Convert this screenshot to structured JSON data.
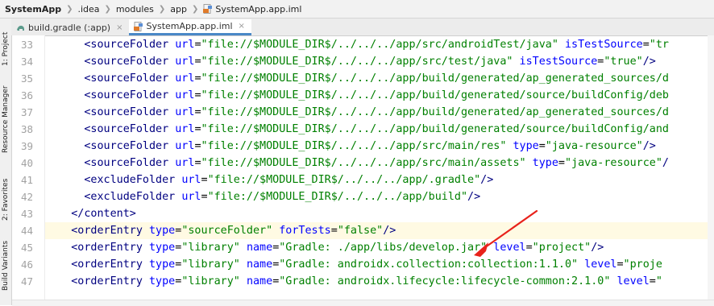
{
  "breadcrumb": [
    {
      "label": "SystemApp",
      "bold": true
    },
    {
      "label": ".idea"
    },
    {
      "label": "modules"
    },
    {
      "label": "app"
    },
    {
      "label": "SystemApp.app.iml",
      "icon": "xml-file-icon"
    }
  ],
  "tabs": [
    {
      "label": "build.gradle (:app)",
      "icon": "gradle-file-icon",
      "active": false
    },
    {
      "label": "SystemApp.app.iml",
      "icon": "xml-file-icon",
      "active": true
    }
  ],
  "side_panels": [
    "1: Project",
    "Resource Manager",
    "2: Favorites",
    "Build Variants"
  ],
  "lines": [
    {
      "n": "33",
      "indent": "      ",
      "tokens": [
        [
          "tag",
          "<sourceFolder "
        ],
        [
          "attr",
          "url"
        ],
        [
          "punct",
          "="
        ],
        [
          "val",
          "\"file://$MODULE_DIR$/../../../app/src/androidTest/java\""
        ],
        [
          "punct",
          " "
        ],
        [
          "attr",
          "isTestSource"
        ],
        [
          "punct",
          "="
        ],
        [
          "val",
          "\"tr"
        ]
      ]
    },
    {
      "n": "34",
      "indent": "      ",
      "tokens": [
        [
          "tag",
          "<sourceFolder "
        ],
        [
          "attr",
          "url"
        ],
        [
          "punct",
          "="
        ],
        [
          "val",
          "\"file://$MODULE_DIR$/../../../app/src/test/java\""
        ],
        [
          "punct",
          " "
        ],
        [
          "attr",
          "isTestSource"
        ],
        [
          "punct",
          "="
        ],
        [
          "val",
          "\"true\""
        ],
        [
          "tag",
          "/>"
        ]
      ]
    },
    {
      "n": "35",
      "indent": "      ",
      "tokens": [
        [
          "tag",
          "<sourceFolder "
        ],
        [
          "attr",
          "url"
        ],
        [
          "punct",
          "="
        ],
        [
          "val",
          "\"file://$MODULE_DIR$/../../../app/build/generated/ap_generated_sources/d"
        ]
      ]
    },
    {
      "n": "36",
      "indent": "      ",
      "tokens": [
        [
          "tag",
          "<sourceFolder "
        ],
        [
          "attr",
          "url"
        ],
        [
          "punct",
          "="
        ],
        [
          "val",
          "\"file://$MODULE_DIR$/../../../app/build/generated/source/buildConfig/deb"
        ]
      ]
    },
    {
      "n": "37",
      "indent": "      ",
      "tokens": [
        [
          "tag",
          "<sourceFolder "
        ],
        [
          "attr",
          "url"
        ],
        [
          "punct",
          "="
        ],
        [
          "val",
          "\"file://$MODULE_DIR$/../../../app/build/generated/ap_generated_sources/d"
        ]
      ]
    },
    {
      "n": "38",
      "indent": "      ",
      "tokens": [
        [
          "tag",
          "<sourceFolder "
        ],
        [
          "attr",
          "url"
        ],
        [
          "punct",
          "="
        ],
        [
          "val",
          "\"file://$MODULE_DIR$/../../../app/build/generated/source/buildConfig/and"
        ]
      ]
    },
    {
      "n": "39",
      "indent": "      ",
      "tokens": [
        [
          "tag",
          "<sourceFolder "
        ],
        [
          "attr",
          "url"
        ],
        [
          "punct",
          "="
        ],
        [
          "val",
          "\"file://$MODULE_DIR$/../../../app/src/main/res\""
        ],
        [
          "punct",
          " "
        ],
        [
          "attr",
          "type"
        ],
        [
          "punct",
          "="
        ],
        [
          "val",
          "\"java-resource\""
        ],
        [
          "tag",
          "/>"
        ]
      ]
    },
    {
      "n": "40",
      "indent": "      ",
      "tokens": [
        [
          "tag",
          "<sourceFolder "
        ],
        [
          "attr",
          "url"
        ],
        [
          "punct",
          "="
        ],
        [
          "val",
          "\"file://$MODULE_DIR$/../../../app/src/main/assets\""
        ],
        [
          "punct",
          " "
        ],
        [
          "attr",
          "type"
        ],
        [
          "punct",
          "="
        ],
        [
          "val",
          "\"java-resource\""
        ],
        [
          "tag",
          "/"
        ]
      ]
    },
    {
      "n": "41",
      "indent": "      ",
      "tokens": [
        [
          "tag",
          "<excludeFolder "
        ],
        [
          "attr",
          "url"
        ],
        [
          "punct",
          "="
        ],
        [
          "val",
          "\"file://$MODULE_DIR$/../../../app/.gradle\""
        ],
        [
          "tag",
          "/>"
        ]
      ]
    },
    {
      "n": "42",
      "indent": "      ",
      "tokens": [
        [
          "tag",
          "<excludeFolder "
        ],
        [
          "attr",
          "url"
        ],
        [
          "punct",
          "="
        ],
        [
          "val",
          "\"file://$MODULE_DIR$/../../../app/build\""
        ],
        [
          "tag",
          "/>"
        ]
      ]
    },
    {
      "n": "43",
      "indent": "    ",
      "tokens": [
        [
          "tag",
          "</content>"
        ]
      ]
    },
    {
      "n": "44",
      "indent": "    ",
      "current": true,
      "tokens": [
        [
          "tag",
          "<orderEntry "
        ],
        [
          "attr",
          "type"
        ],
        [
          "punct",
          "="
        ],
        [
          "val",
          "\"sourceFolder\""
        ],
        [
          "punct",
          " "
        ],
        [
          "attr",
          "forTests"
        ],
        [
          "punct",
          "="
        ],
        [
          "val",
          "\"false\""
        ],
        [
          "tag",
          "/>"
        ]
      ]
    },
    {
      "n": "45",
      "indent": "    ",
      "tokens": [
        [
          "tag",
          "<orderEntry "
        ],
        [
          "attr",
          "type"
        ],
        [
          "punct",
          "="
        ],
        [
          "val",
          "\"library\""
        ],
        [
          "punct",
          " "
        ],
        [
          "attr",
          "name"
        ],
        [
          "punct",
          "="
        ],
        [
          "val",
          "\"Gradle: ./app/libs/develop.jar\""
        ],
        [
          "punct",
          " "
        ],
        [
          "attr",
          "level"
        ],
        [
          "punct",
          "="
        ],
        [
          "val",
          "\"project\""
        ],
        [
          "tag",
          "/>"
        ]
      ]
    },
    {
      "n": "46",
      "indent": "    ",
      "tokens": [
        [
          "tag",
          "<orderEntry "
        ],
        [
          "attr",
          "type"
        ],
        [
          "punct",
          "="
        ],
        [
          "val",
          "\"library\""
        ],
        [
          "punct",
          " "
        ],
        [
          "attr",
          "name"
        ],
        [
          "punct",
          "="
        ],
        [
          "val",
          "\"Gradle: androidx.collection:collection:1.1.0\""
        ],
        [
          "punct",
          " "
        ],
        [
          "attr",
          "level"
        ],
        [
          "punct",
          "="
        ],
        [
          "val",
          "\"proje"
        ]
      ]
    },
    {
      "n": "47",
      "indent": "    ",
      "tokens": [
        [
          "tag",
          "<orderEntry "
        ],
        [
          "attr",
          "type"
        ],
        [
          "punct",
          "="
        ],
        [
          "val",
          "\"library\""
        ],
        [
          "punct",
          " "
        ],
        [
          "attr",
          "name"
        ],
        [
          "punct",
          "="
        ],
        [
          "val",
          "\"Gradle: androidx.lifecycle:lifecycle-common:2.1.0\""
        ],
        [
          "punct",
          " "
        ],
        [
          "attr",
          "level"
        ],
        [
          "punct",
          "="
        ],
        [
          "val",
          "\""
        ]
      ]
    }
  ],
  "colors": {
    "tag": "#000080",
    "attr": "#0000ff",
    "value": "#008000",
    "annotation_arrow": "#e8221b",
    "active_tab_underline": "#4a88c7"
  }
}
